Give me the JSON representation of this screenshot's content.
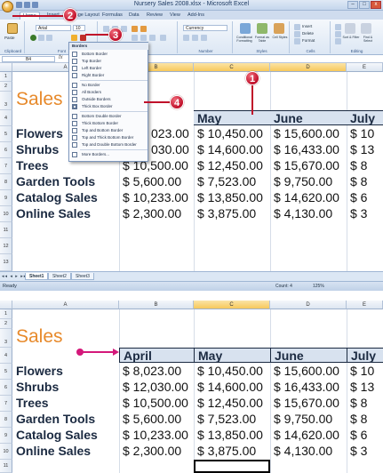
{
  "window": {
    "title": "Nursery Sales 2008.xlsx - Microsoft Excel",
    "win_buttons": [
      "–",
      "□",
      "x"
    ]
  },
  "ribbon": {
    "tabs": [
      "Home",
      "Insert",
      "Page Layout",
      "Formulas",
      "Data",
      "Review",
      "View",
      "Add-Ins"
    ],
    "font_name": "Arial",
    "font_size": "10",
    "number_format": "Currency",
    "groups": [
      "Clipboard",
      "Font",
      "Alignment",
      "Number",
      "Styles",
      "Cells",
      "Editing"
    ],
    "styles_buttons": [
      "Conditional Formatting",
      "Format as Table",
      "Cell Styles"
    ],
    "cells_buttons": [
      "Insert",
      "Delete",
      "Format"
    ],
    "editing_buttons": [
      "Sort & Filter",
      "Find & Select"
    ],
    "paste_label": "Paste"
  },
  "formula_bar": {
    "name_box": "B4",
    "fx": "fx"
  },
  "columns": [
    "A",
    "B",
    "C",
    "D",
    "E"
  ],
  "rows": [
    "1",
    "2",
    "3",
    "4",
    "5",
    "6",
    "7",
    "8",
    "9",
    "10",
    "11",
    "12",
    "13",
    "14"
  ],
  "bottom_rows": [
    "1",
    "2",
    "3",
    "4",
    "5",
    "6",
    "7",
    "8",
    "9",
    "10",
    "11"
  ],
  "sheet": {
    "heading": "Sales",
    "months": [
      "April",
      "May",
      "June",
      "July"
    ],
    "top_months_visible": [
      "May",
      "June",
      "July"
    ],
    "items": [
      {
        "label": "Flowers",
        "april": "$ 8,023.00",
        "may": "$ 10,450.00",
        "june": "$ 15,600.00",
        "july": "$ 10"
      },
      {
        "label": "Shrubs",
        "april": "$ 12,030.00",
        "may": "$ 14,600.00",
        "june": "$ 16,433.00",
        "july": "$ 13"
      },
      {
        "label": "Trees",
        "april": "$ 10,500.00",
        "may": "$ 12,450.00",
        "june": "$ 15,670.00",
        "july": "$ 8"
      },
      {
        "label": "Garden Tools",
        "april": "$ 5,600.00",
        "may": "$ 7,523.00",
        "june": "$ 9,750.00",
        "july": "$ 8"
      },
      {
        "label": "Catalog Sales",
        "april": "$ 10,233.00",
        "may": "$ 13,850.00",
        "june": "$ 14,620.00",
        "july": "$ 6"
      },
      {
        "label": "Online Sales",
        "april": "$ 2,300.00",
        "may": "$ 3,875.00",
        "june": "$ 4,130.00",
        "july": "$ 3"
      }
    ],
    "top_partial_april": [
      "023.00",
      "030.00",
      "$ 10,500.00",
      "$ 5,600.00",
      "$ 10,233.00",
      "$ 2,300.00"
    ]
  },
  "borders_menu": {
    "header": "Borders",
    "items": [
      "Bottom Border",
      "Top Border",
      "Left Border",
      "Right Border",
      "No Border",
      "All Borders",
      "Outside Borders",
      "Thick Box Border",
      "Bottom Double Border",
      "Thick Bottom Border",
      "Top and Bottom Border",
      "Top and Thick Bottom Border",
      "Top and Double Bottom Border",
      "More Borders..."
    ]
  },
  "sheet_tabs": [
    "Sheet1",
    "Sheet2",
    "Sheet3"
  ],
  "status": {
    "ready": "Ready",
    "count": "Count: 4",
    "zoom": "125%"
  },
  "callouts": [
    "1",
    "2",
    "3",
    "4"
  ],
  "colors": {
    "heading": "#e78a2c",
    "callout": "#c0102a",
    "header_fill": "#d8e2ef",
    "selected_column": "#f7c85b"
  }
}
